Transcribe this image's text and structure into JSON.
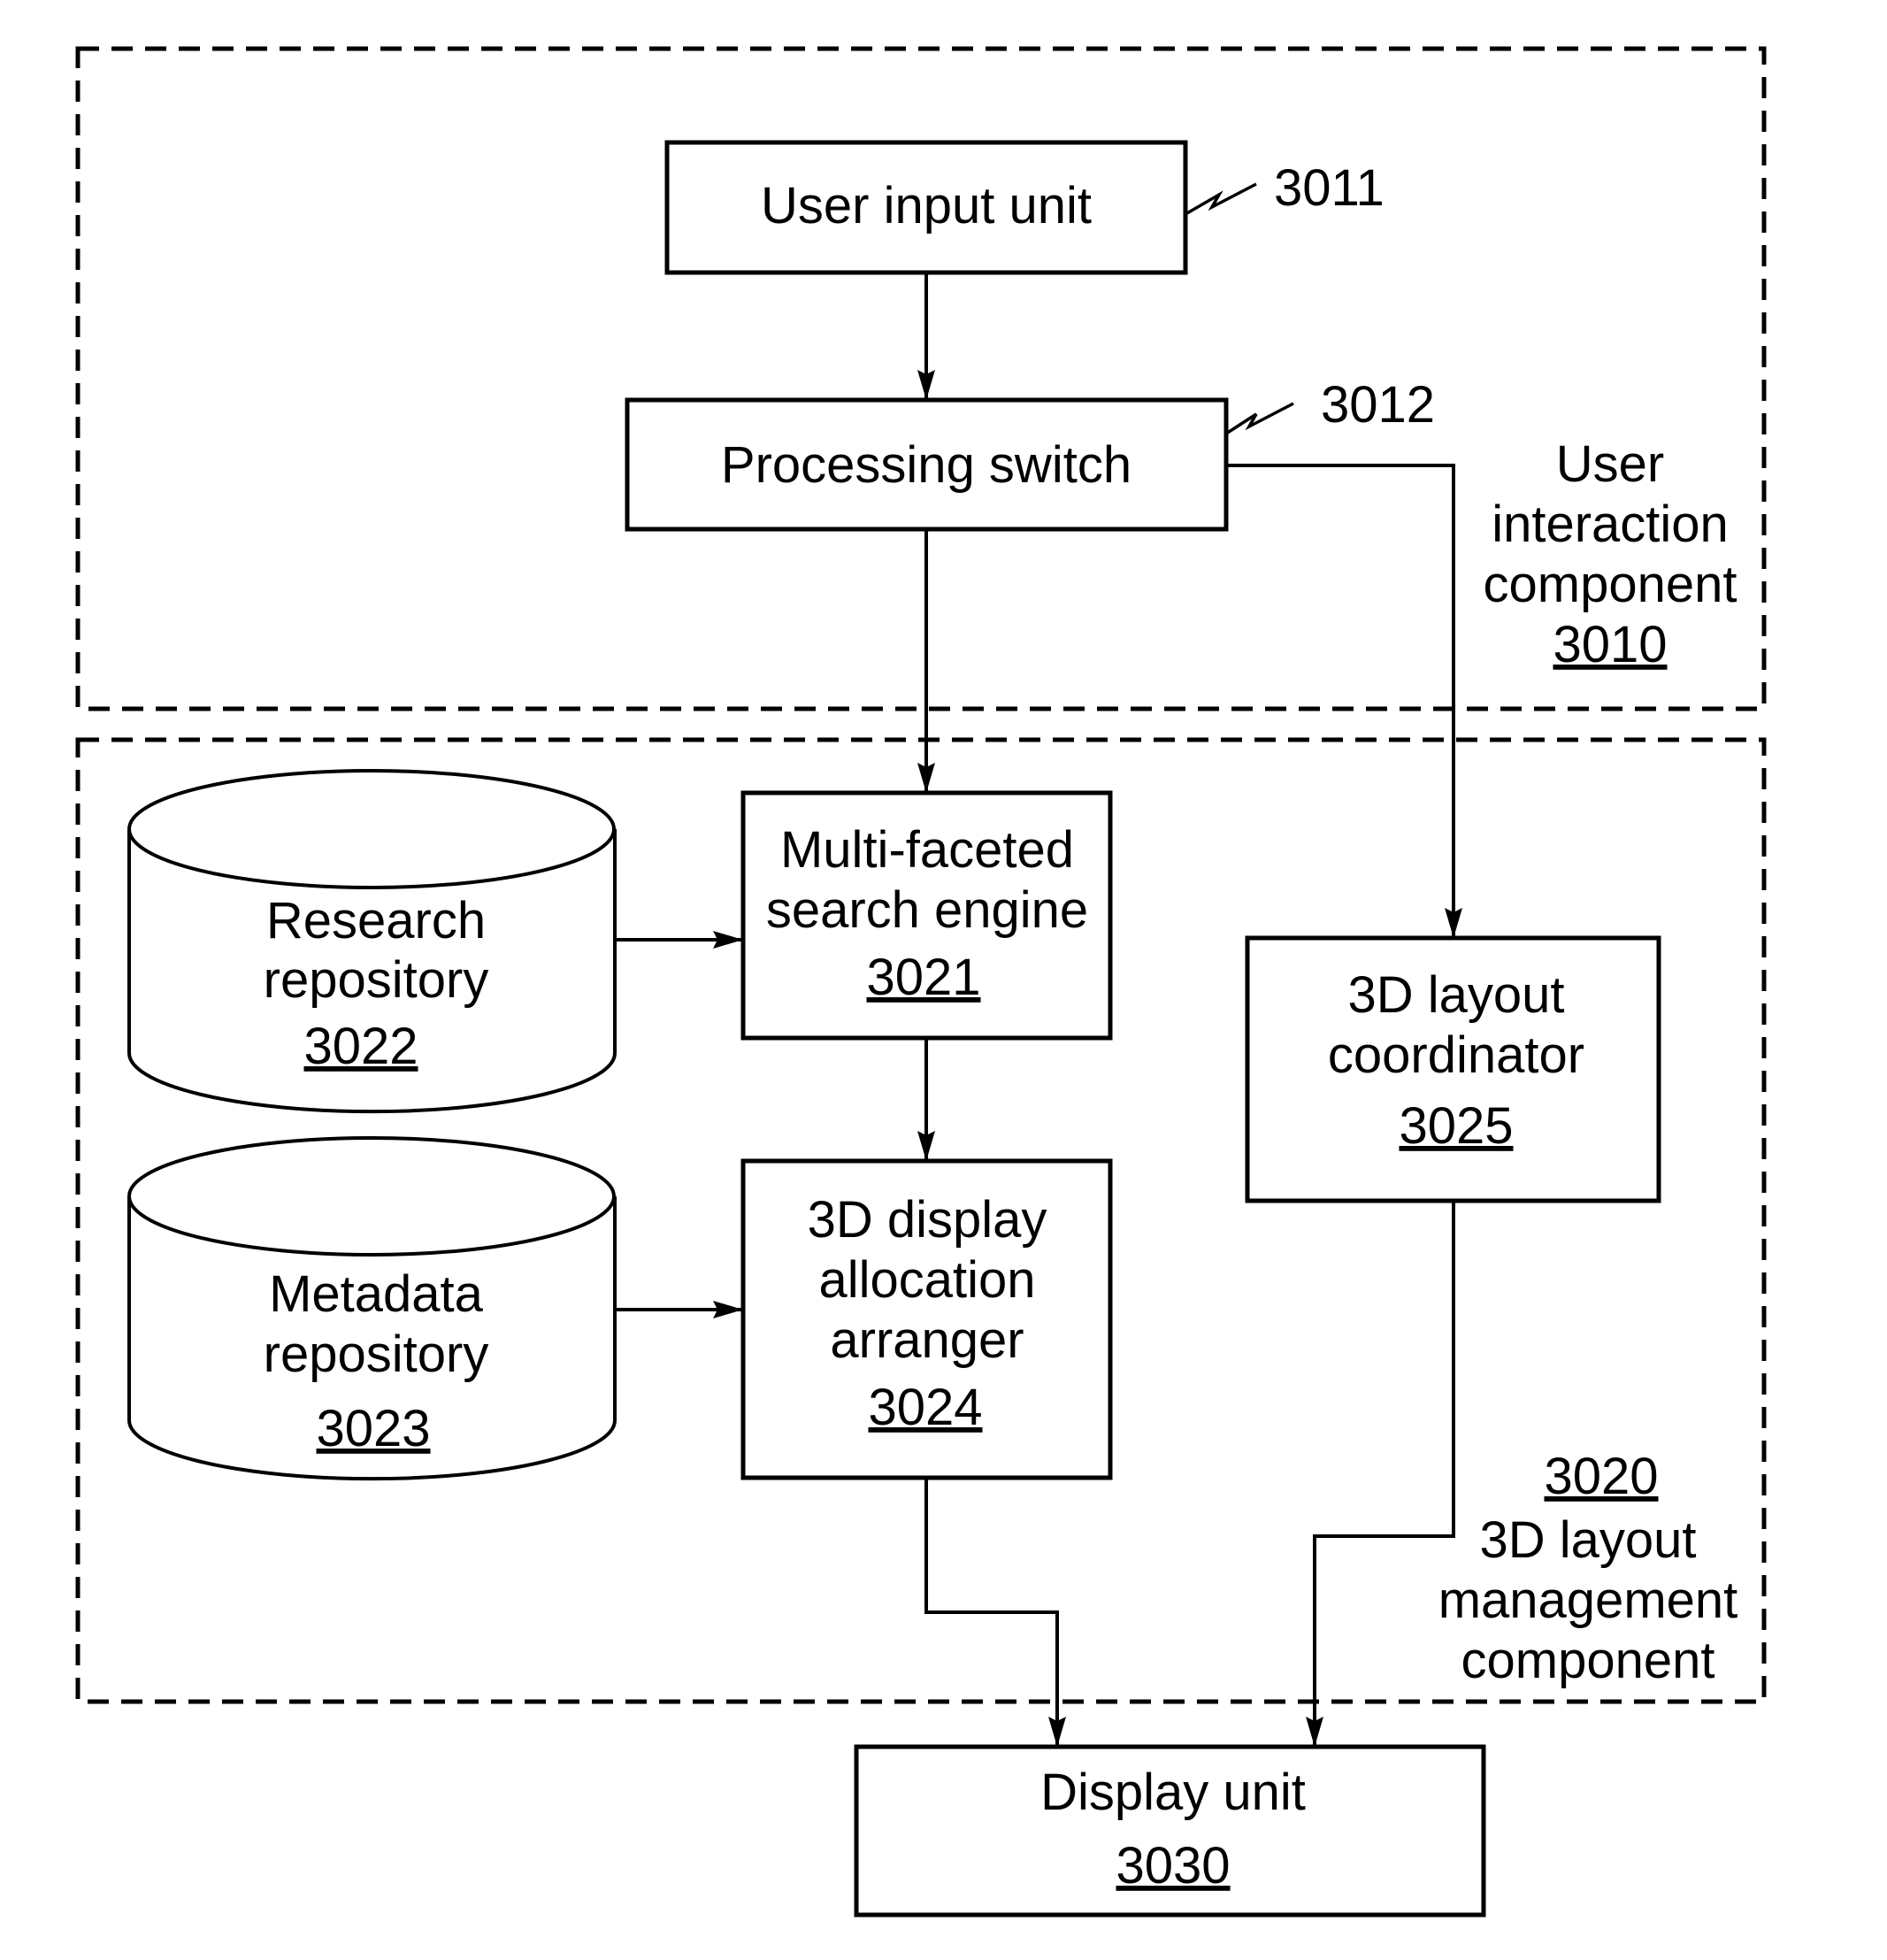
{
  "diagram": {
    "groups": {
      "user_interaction": {
        "lines": [
          "User",
          "interaction",
          "component"
        ],
        "number": "3010"
      },
      "layout_management": {
        "number": "3020",
        "lines": [
          "3D layout",
          "management",
          "component"
        ]
      }
    },
    "nodes": {
      "user_input": {
        "lines": [
          "User input unit"
        ],
        "ref": "3011"
      },
      "processing_switch": {
        "lines": [
          "Processing switch"
        ],
        "ref": "3012"
      },
      "search_engine": {
        "lines": [
          "Multi-faceted",
          "search engine"
        ],
        "number": "3021"
      },
      "research_repo": {
        "lines": [
          "Research",
          "repository"
        ],
        "number": "3022"
      },
      "metadata_repo": {
        "lines": [
          "Metadata",
          "repository"
        ],
        "number": "3023"
      },
      "allocation_arranger": {
        "lines": [
          "3D display",
          "allocation",
          "arranger"
        ],
        "number": "3024"
      },
      "layout_coordinator": {
        "lines": [
          "3D layout",
          "coordinator"
        ],
        "number": "3025"
      },
      "display_unit": {
        "lines": [
          "Display unit"
        ],
        "number": "3030"
      }
    },
    "edges": [
      {
        "from": "user_input",
        "to": "processing_switch"
      },
      {
        "from": "processing_switch",
        "to": "search_engine"
      },
      {
        "from": "processing_switch",
        "to": "layout_coordinator"
      },
      {
        "from": "research_repo",
        "to": "search_engine"
      },
      {
        "from": "search_engine",
        "to": "allocation_arranger"
      },
      {
        "from": "metadata_repo",
        "to": "allocation_arranger"
      },
      {
        "from": "allocation_arranger",
        "to": "display_unit"
      },
      {
        "from": "layout_coordinator",
        "to": "display_unit"
      }
    ]
  }
}
